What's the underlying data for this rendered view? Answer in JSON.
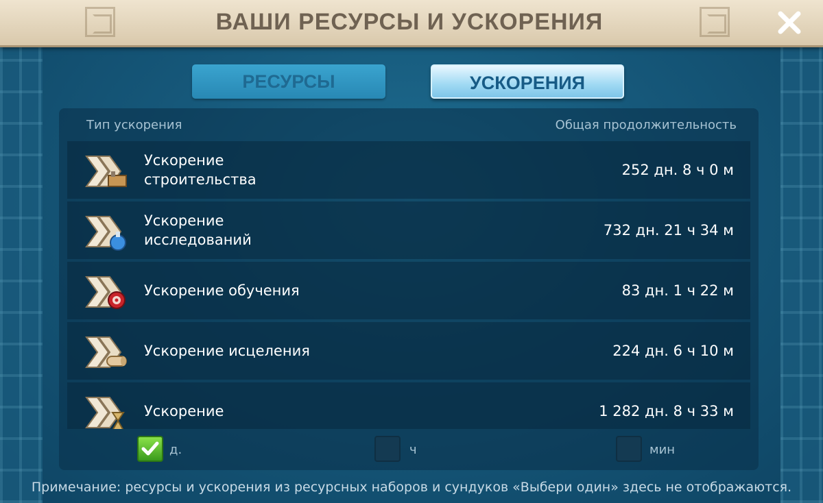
{
  "window": {
    "title": "ВАШИ РЕСУРСЫ И УСКОРЕНИЯ"
  },
  "tabs": [
    {
      "label": "РЕСУРСЫ",
      "active": false
    },
    {
      "label": "УСКОРЕНИЯ",
      "active": true
    }
  ],
  "table": {
    "columns": [
      "Тип ускорения",
      "Общая продолжительность"
    ],
    "rows": [
      {
        "name": "Ускорение\nстроительства",
        "value": "252 дн. 8 ч 0 м",
        "icon": "construction-speedup-icon"
      },
      {
        "name": "Ускорение\nисследований",
        "value": "732 дн. 21 ч 34 м",
        "icon": "research-speedup-icon"
      },
      {
        "name": "Ускорение обучения",
        "value": "83 дн. 1 ч 22 м",
        "icon": "training-speedup-icon"
      },
      {
        "name": "Ускорение исцеления",
        "value": "224 дн. 6 ч 10 м",
        "icon": "healing-speedup-icon"
      },
      {
        "name": "Ускорение",
        "value": "1 282 дн. 8 ч 33 м",
        "icon": "universal-speedup-icon"
      }
    ]
  },
  "filters": [
    {
      "label": "д.",
      "checked": true
    },
    {
      "label": "ч",
      "checked": false
    },
    {
      "label": "мин",
      "checked": false
    }
  ],
  "note": "Примечание: ресурсы и ускорения из ресурсных наборов и сундуков «Выбери один» здесь не отображаются.",
  "colors": {
    "background": "#16587a",
    "title_bar": "#e6d9bf",
    "title_text": "#6f6252",
    "active_tab": "#9fd9f3",
    "inactive_tab": "#2f95c1",
    "checkbox_checked": "#5cc22e"
  }
}
